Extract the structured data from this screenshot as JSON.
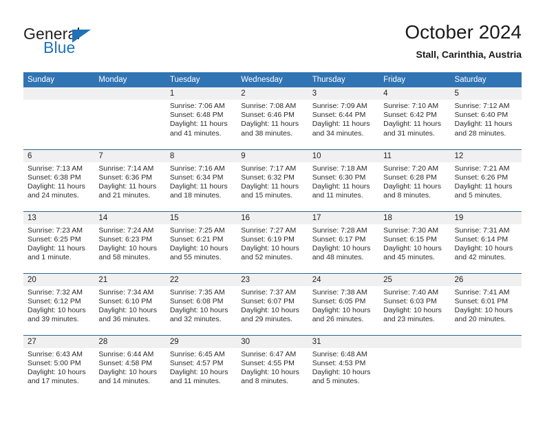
{
  "brand": {
    "name_top": "General",
    "name_bottom": "Blue",
    "triangle_color": "#1f72b8"
  },
  "header": {
    "title": "October 2024",
    "subtitle": "Stall, Carinthia, Austria"
  },
  "theme": {
    "header_blue": "#3174b4",
    "row_divider": "#2e628c",
    "day_number_band": "#f0f0f0",
    "brand_blue": "#1f72b8"
  },
  "weekday_headers": [
    "Sunday",
    "Monday",
    "Tuesday",
    "Wednesday",
    "Thursday",
    "Friday",
    "Saturday"
  ],
  "weeks": [
    [
      {
        "day": "",
        "empty": true
      },
      {
        "day": "",
        "empty": true
      },
      {
        "day": "1",
        "sunrise": "Sunrise: 7:06 AM",
        "sunset": "Sunset: 6:48 PM",
        "daylight": "Daylight: 11 hours and 41 minutes."
      },
      {
        "day": "2",
        "sunrise": "Sunrise: 7:08 AM",
        "sunset": "Sunset: 6:46 PM",
        "daylight": "Daylight: 11 hours and 38 minutes."
      },
      {
        "day": "3",
        "sunrise": "Sunrise: 7:09 AM",
        "sunset": "Sunset: 6:44 PM",
        "daylight": "Daylight: 11 hours and 34 minutes."
      },
      {
        "day": "4",
        "sunrise": "Sunrise: 7:10 AM",
        "sunset": "Sunset: 6:42 PM",
        "daylight": "Daylight: 11 hours and 31 minutes."
      },
      {
        "day": "5",
        "sunrise": "Sunrise: 7:12 AM",
        "sunset": "Sunset: 6:40 PM",
        "daylight": "Daylight: 11 hours and 28 minutes."
      }
    ],
    [
      {
        "day": "6",
        "sunrise": "Sunrise: 7:13 AM",
        "sunset": "Sunset: 6:38 PM",
        "daylight": "Daylight: 11 hours and 24 minutes."
      },
      {
        "day": "7",
        "sunrise": "Sunrise: 7:14 AM",
        "sunset": "Sunset: 6:36 PM",
        "daylight": "Daylight: 11 hours and 21 minutes."
      },
      {
        "day": "8",
        "sunrise": "Sunrise: 7:16 AM",
        "sunset": "Sunset: 6:34 PM",
        "daylight": "Daylight: 11 hours and 18 minutes."
      },
      {
        "day": "9",
        "sunrise": "Sunrise: 7:17 AM",
        "sunset": "Sunset: 6:32 PM",
        "daylight": "Daylight: 11 hours and 15 minutes."
      },
      {
        "day": "10",
        "sunrise": "Sunrise: 7:18 AM",
        "sunset": "Sunset: 6:30 PM",
        "daylight": "Daylight: 11 hours and 11 minutes."
      },
      {
        "day": "11",
        "sunrise": "Sunrise: 7:20 AM",
        "sunset": "Sunset: 6:28 PM",
        "daylight": "Daylight: 11 hours and 8 minutes."
      },
      {
        "day": "12",
        "sunrise": "Sunrise: 7:21 AM",
        "sunset": "Sunset: 6:26 PM",
        "daylight": "Daylight: 11 hours and 5 minutes."
      }
    ],
    [
      {
        "day": "13",
        "sunrise": "Sunrise: 7:23 AM",
        "sunset": "Sunset: 6:25 PM",
        "daylight": "Daylight: 11 hours and 1 minute."
      },
      {
        "day": "14",
        "sunrise": "Sunrise: 7:24 AM",
        "sunset": "Sunset: 6:23 PM",
        "daylight": "Daylight: 10 hours and 58 minutes."
      },
      {
        "day": "15",
        "sunrise": "Sunrise: 7:25 AM",
        "sunset": "Sunset: 6:21 PM",
        "daylight": "Daylight: 10 hours and 55 minutes."
      },
      {
        "day": "16",
        "sunrise": "Sunrise: 7:27 AM",
        "sunset": "Sunset: 6:19 PM",
        "daylight": "Daylight: 10 hours and 52 minutes."
      },
      {
        "day": "17",
        "sunrise": "Sunrise: 7:28 AM",
        "sunset": "Sunset: 6:17 PM",
        "daylight": "Daylight: 10 hours and 48 minutes."
      },
      {
        "day": "18",
        "sunrise": "Sunrise: 7:30 AM",
        "sunset": "Sunset: 6:15 PM",
        "daylight": "Daylight: 10 hours and 45 minutes."
      },
      {
        "day": "19",
        "sunrise": "Sunrise: 7:31 AM",
        "sunset": "Sunset: 6:14 PM",
        "daylight": "Daylight: 10 hours and 42 minutes."
      }
    ],
    [
      {
        "day": "20",
        "sunrise": "Sunrise: 7:32 AM",
        "sunset": "Sunset: 6:12 PM",
        "daylight": "Daylight: 10 hours and 39 minutes."
      },
      {
        "day": "21",
        "sunrise": "Sunrise: 7:34 AM",
        "sunset": "Sunset: 6:10 PM",
        "daylight": "Daylight: 10 hours and 36 minutes."
      },
      {
        "day": "22",
        "sunrise": "Sunrise: 7:35 AM",
        "sunset": "Sunset: 6:08 PM",
        "daylight": "Daylight: 10 hours and 32 minutes."
      },
      {
        "day": "23",
        "sunrise": "Sunrise: 7:37 AM",
        "sunset": "Sunset: 6:07 PM",
        "daylight": "Daylight: 10 hours and 29 minutes."
      },
      {
        "day": "24",
        "sunrise": "Sunrise: 7:38 AM",
        "sunset": "Sunset: 6:05 PM",
        "daylight": "Daylight: 10 hours and 26 minutes."
      },
      {
        "day": "25",
        "sunrise": "Sunrise: 7:40 AM",
        "sunset": "Sunset: 6:03 PM",
        "daylight": "Daylight: 10 hours and 23 minutes."
      },
      {
        "day": "26",
        "sunrise": "Sunrise: 7:41 AM",
        "sunset": "Sunset: 6:01 PM",
        "daylight": "Daylight: 10 hours and 20 minutes."
      }
    ],
    [
      {
        "day": "27",
        "sunrise": "Sunrise: 6:43 AM",
        "sunset": "Sunset: 5:00 PM",
        "daylight": "Daylight: 10 hours and 17 minutes."
      },
      {
        "day": "28",
        "sunrise": "Sunrise: 6:44 AM",
        "sunset": "Sunset: 4:58 PM",
        "daylight": "Daylight: 10 hours and 14 minutes."
      },
      {
        "day": "29",
        "sunrise": "Sunrise: 6:45 AM",
        "sunset": "Sunset: 4:57 PM",
        "daylight": "Daylight: 10 hours and 11 minutes."
      },
      {
        "day": "30",
        "sunrise": "Sunrise: 6:47 AM",
        "sunset": "Sunset: 4:55 PM",
        "daylight": "Daylight: 10 hours and 8 minutes."
      },
      {
        "day": "31",
        "sunrise": "Sunrise: 6:48 AM",
        "sunset": "Sunset: 4:53 PM",
        "daylight": "Daylight: 10 hours and 5 minutes."
      },
      {
        "day": "",
        "empty": true
      },
      {
        "day": "",
        "empty": true
      }
    ]
  ]
}
